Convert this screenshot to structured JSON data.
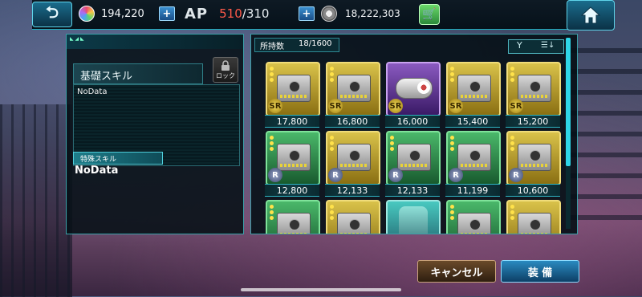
{
  "topbar": {
    "gems": "194,220",
    "ap_label": "AP",
    "ap_current": "510",
    "ap_max": "/310",
    "coins": "18,222,303",
    "back_icon": "back-arrow-icon",
    "home_icon": "home-icon",
    "shop_icon": "shop-icon"
  },
  "left_panel": {
    "base_skill_label": "基礎スキル",
    "lock_label": "ロック",
    "base_skill_text": "NoData",
    "special_skill_label": "特殊スキル",
    "special_skill_text": "NoData"
  },
  "right_panel": {
    "count_label": "所持数",
    "count_value": "18/1600",
    "filter_icon": "filter-icon",
    "sort_icon": "sort-icon"
  },
  "cards": [
    {
      "price": "17,800",
      "rarity": "SR",
      "type": "chip",
      "color": "#d9c24a"
    },
    {
      "price": "16,800",
      "rarity": "SR",
      "type": "chip",
      "color": "#d9c24a"
    },
    {
      "price": "16,000",
      "rarity": "SR",
      "type": "cylinder",
      "color": "#8a5ac0"
    },
    {
      "price": "15,400",
      "rarity": "SR",
      "type": "chip",
      "color": "#d9c24a"
    },
    {
      "price": "15,200",
      "rarity": "SR",
      "type": "chip",
      "color": "#d9c24a"
    },
    {
      "price": "12,800",
      "rarity": "R",
      "type": "chip",
      "color": "#4ab86a"
    },
    {
      "price": "12,133",
      "rarity": "R",
      "type": "chip",
      "color": "#d9c24a"
    },
    {
      "price": "12,133",
      "rarity": "R",
      "type": "chip",
      "color": "#4ab86a"
    },
    {
      "price": "11,199",
      "rarity": "R",
      "type": "chip",
      "color": "#4ab86a"
    },
    {
      "price": "10,600",
      "rarity": "R",
      "type": "chip",
      "color": "#d9c24a"
    },
    {
      "price": "",
      "rarity": "",
      "type": "chip",
      "color": "#4ab86a"
    },
    {
      "price": "",
      "rarity": "",
      "type": "chip",
      "color": "#d9c24a"
    },
    {
      "price": "",
      "rarity": "",
      "type": "robot",
      "color": "#49c9c0"
    },
    {
      "price": "",
      "rarity": "",
      "type": "chip",
      "color": "#4ab86a"
    },
    {
      "price": "",
      "rarity": "",
      "type": "chip",
      "color": "#d9c24a"
    }
  ],
  "buttons": {
    "cancel": "キャンセル",
    "equip": "装 備"
  }
}
